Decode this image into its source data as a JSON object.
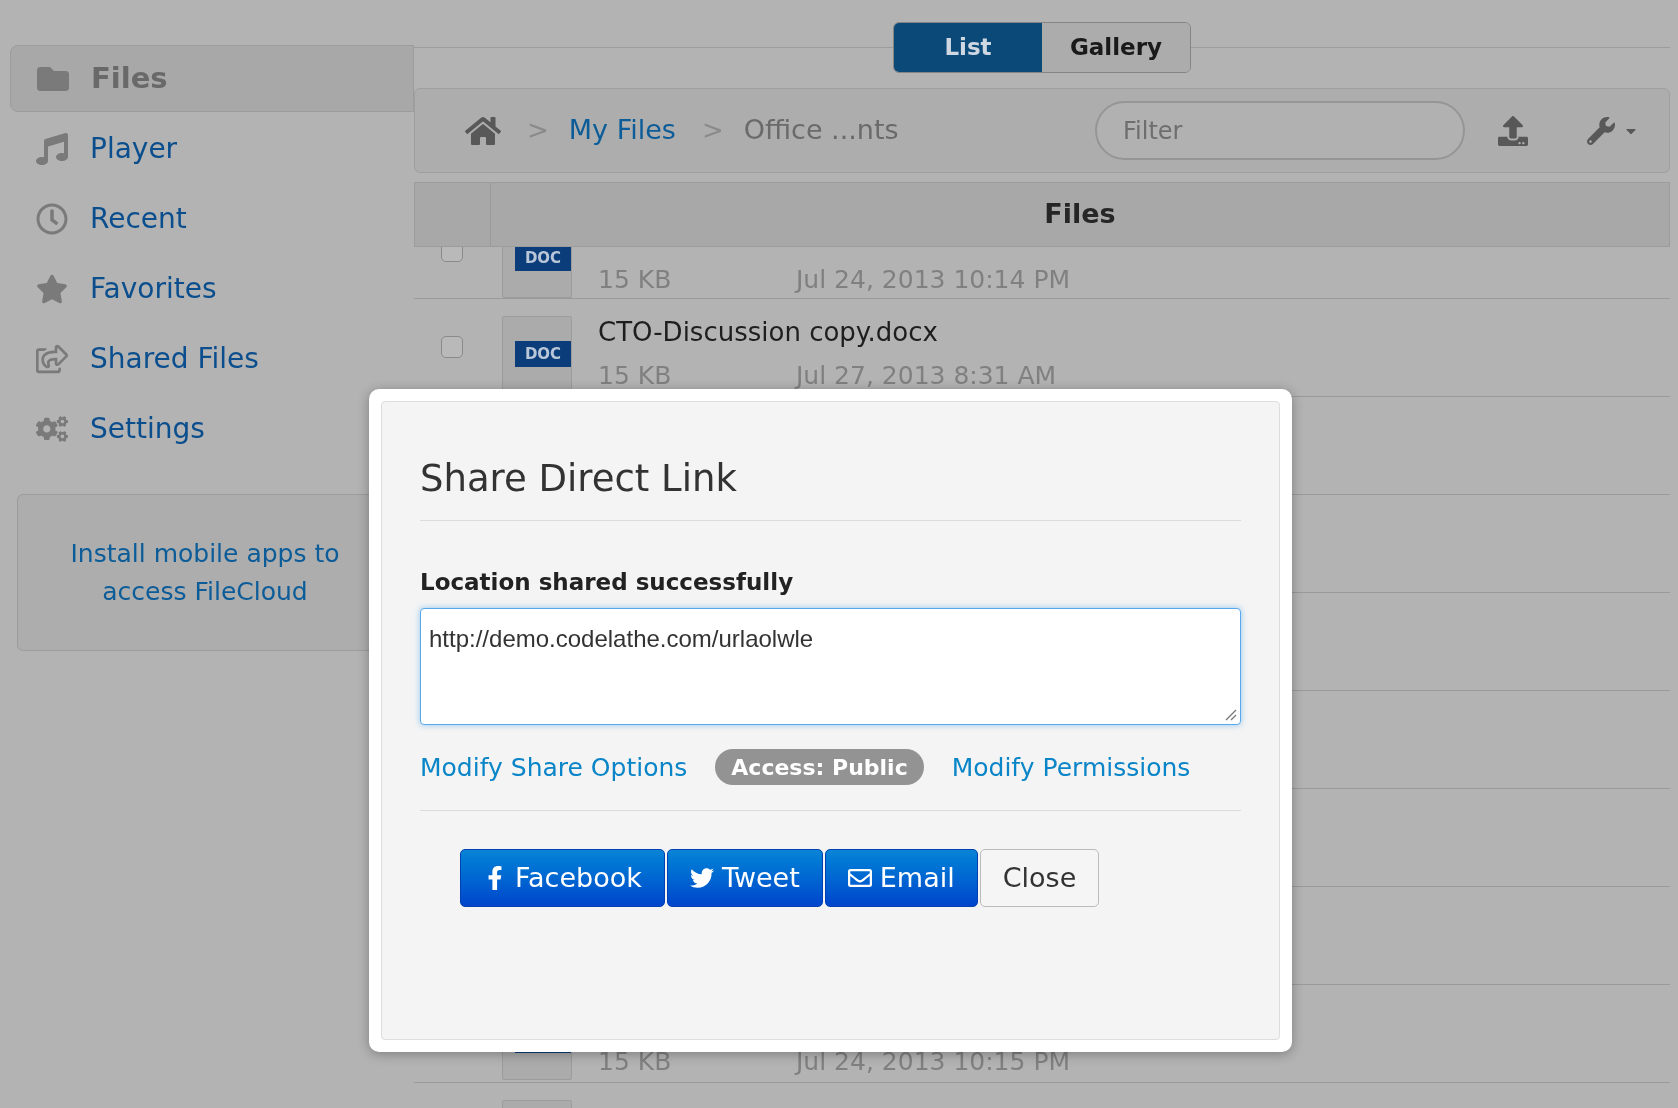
{
  "sidebar": {
    "items": [
      {
        "label": "Files",
        "kind": "folder",
        "selected": true
      },
      {
        "label": "Player",
        "kind": "music",
        "selected": false
      },
      {
        "label": "Recent",
        "kind": "clock",
        "selected": false
      },
      {
        "label": "Favorites",
        "kind": "star",
        "selected": false
      },
      {
        "label": "Shared Files",
        "kind": "share",
        "selected": false
      },
      {
        "label": "Settings",
        "kind": "gears",
        "selected": false
      }
    ],
    "promo": "Install mobile apps to access FileCloud"
  },
  "view_toggle": [
    {
      "label": "List",
      "selected": true
    },
    {
      "label": "Gallery",
      "selected": false
    }
  ],
  "breadcrumb": [
    {
      "separator": ">",
      "label": "My Files",
      "kind": "link"
    },
    {
      "separator": ">",
      "label": "Office ...nts",
      "kind": "current"
    }
  ],
  "filter": {
    "placeholder": "Filter"
  },
  "table": {
    "columns": [
      "Files"
    ],
    "rows": [
      {
        "badge": "DOC",
        "size": "15 KB",
        "date": "Jul 24, 2013 10:14 PM",
        "checked": false
      },
      {
        "badge": "DOC",
        "name": "CTO-Discussion copy.docx",
        "size": "15 KB",
        "date": "Jul 27, 2013 8:31 AM",
        "checked": false
      },
      {
        "size": "15 KB",
        "date": "Jul 24, 2013 10:15 PM"
      }
    ]
  },
  "dialog": {
    "title": "Share Direct Link",
    "label": "Location shared successfully",
    "link_value": "http://demo.codelathe.com/urlaolwle",
    "actions": [
      {
        "kind": "link",
        "label": "Modify Share Options"
      },
      {
        "kind": "badge",
        "label": "Access: Public"
      },
      {
        "kind": "link",
        "label": "Modify Permissions"
      }
    ],
    "buttons": [
      {
        "kind": "facebook",
        "label": "Facebook"
      },
      {
        "kind": "twitter",
        "label": "Tweet"
      },
      {
        "kind": "email",
        "label": "Email"
      },
      {
        "kind": "plain",
        "label": "Close"
      }
    ]
  }
}
